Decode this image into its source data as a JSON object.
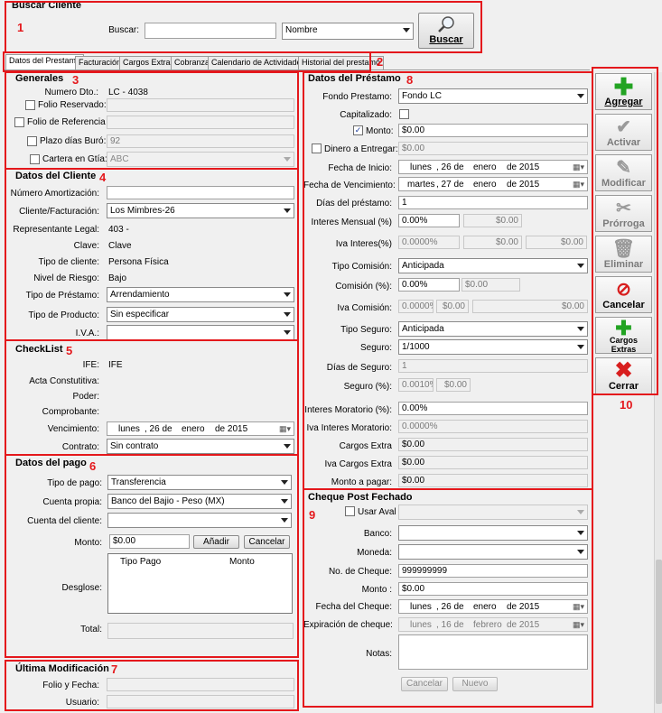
{
  "annotations": {
    "n1": "1",
    "n2": "2",
    "n3": "3",
    "n4": "4",
    "n5": "5",
    "n6": "6",
    "n7": "7",
    "n8": "8",
    "n9": "9",
    "n10": "10"
  },
  "search": {
    "title": "Buscar Cliente",
    "label": "Buscar:",
    "value": "",
    "field": "Nombre",
    "button": "Buscar"
  },
  "tabs": [
    "Datos del Prestamo",
    "Facturación",
    "Cargos Extras",
    "Cobranza",
    "Calendario de Actividades",
    "Historial del prestamo"
  ],
  "generales": {
    "title": "Generales",
    "numero_label": "Numero Dto.:",
    "numero_value": "LC - 4038",
    "folio_reservado": "Folio Reservado:",
    "folio_referencia": "Folio de Referencia",
    "plazo_buro": "Plazo días Buró:",
    "plazo_buro_value": "92",
    "cartera": "Cartera en Gtía:",
    "cartera_value": "ABC"
  },
  "cliente": {
    "title": "Datos del Cliente",
    "numero_amort": "Número Amortización:",
    "cliente_fact": "Cliente/Facturación:",
    "cliente_fact_value": "Los Mimbres-26",
    "rep_legal": "Representante Legal:",
    "rep_legal_value": "403 -",
    "clave": "Clave:",
    "clave_value": "Clave",
    "tipo_cliente": "Tipo de cliente:",
    "tipo_cliente_value": "Persona Física",
    "riesgo": "Nivel de Riesgo:",
    "riesgo_value": "Bajo",
    "tipo_prestamo": "Tipo de Préstamo:",
    "tipo_prestamo_value": "Arrendamiento",
    "tipo_producto": "Tipo de Producto:",
    "tipo_producto_value": "Sin especificar",
    "iva": "I.V.A.:",
    "iva_value": ""
  },
  "checklist": {
    "title": "CheckList",
    "ife": "IFE:",
    "ife_value": "IFE",
    "acta": "Acta Constutitiva:",
    "poder": "Poder:",
    "comprobante": "Comprobante:",
    "vencimiento": "Vencimiento:",
    "venc_day": "lunes",
    "venc_num": ", 26 de",
    "venc_month": "enero",
    "venc_year": "de 2015",
    "contrato": "Contrato:",
    "contrato_value": "Sin contrato"
  },
  "pago": {
    "title": "Datos del pago",
    "tipo": "Tipo de pago:",
    "tipo_value": "Transferencia",
    "cuenta_propia": "Cuenta propia:",
    "cuenta_propia_value": "Banco del Bajio - Peso (MX)",
    "cuenta_cliente": "Cuenta del cliente:",
    "monto": "Monto:",
    "monto_value": "$0.00",
    "anadir": "Añadir",
    "cancelar": "Cancelar",
    "desglose": "Desglose:",
    "col_tipo": "Tipo Pago",
    "col_monto": "Monto",
    "total": "Total:"
  },
  "ultima": {
    "title": "Última Modificación",
    "folio": "Folio y Fecha:",
    "usuario": "Usuario:"
  },
  "prestamo": {
    "title": "Datos del Préstamo",
    "fondo": "Fondo Prestamo:",
    "fondo_value": "Fondo LC",
    "capitalizado": "Capitalizado:",
    "monto": "Monto:",
    "monto_value": "$0.00",
    "dinero": "Dinero a Entregar:",
    "dinero_value": "$0.00",
    "fecha_inicio": "Fecha de Inicio:",
    "fi_day": "lunes",
    "fi_num": ", 26 de",
    "fi_month": "enero",
    "fi_year": "de 2015",
    "fecha_venc": "Fecha de Vencimiento:",
    "fv_day": "martes",
    "fv_num": ", 27 de",
    "fv_month": "enero",
    "fv_year": "de 2015",
    "dias": "Días del préstamo:",
    "dias_value": "1",
    "int_mensual": "Interes Mensual (%)",
    "int_mensual_value": "0.00%",
    "int_mensual_amt": "$0.00",
    "iva_int": "Iva Interes(%)",
    "iva_int_value": "0.0000%",
    "iva_int_a": "$0.00",
    "iva_int_b": "$0.00",
    "tipo_comision": "Tipo Comisión:",
    "tipo_comision_value": "Anticipada",
    "comision": "Comisión (%):",
    "comision_value": "0.00%",
    "comision_amt": "$0.00",
    "iva_comision": "Iva Comisión:",
    "iva_com_value": "0.0000%",
    "iva_com_a": "$0.00",
    "iva_com_b": "$0.00",
    "tipo_seguro": "Tipo Seguro:",
    "tipo_seguro_value": "Anticipada",
    "seguro": "Seguro:",
    "seguro_value": "1/1000",
    "dias_seguro": "Días de Seguro:",
    "dias_seguro_value": "1",
    "seguro_pct": "Seguro (%):",
    "seguro_pct_value": "0.0010%",
    "seguro_amt": "$0.00",
    "int_mora": "Interes Moratorio (%):",
    "int_mora_value": "0.00%",
    "iva_mora": "Iva Interes Moratorio:",
    "iva_mora_value": "0.0000%",
    "cargos": "Cargos Extra",
    "cargos_value": "$0.00",
    "iva_cargos": "Iva Cargos Extra",
    "iva_cargos_value": "$0.00",
    "monto_pagar": "Monto a pagar:",
    "monto_pagar_value": "$0.00"
  },
  "cheque": {
    "title": "Cheque Post Fechado",
    "usar_aval": "Usar Aval",
    "banco": "Banco:",
    "moneda": "Moneda:",
    "no_cheque": "No. de Cheque:",
    "no_cheque_value": "999999999",
    "monto": "Monto :",
    "monto_value": "$0.00",
    "fecha": "Fecha del Cheque:",
    "fc_day": "lunes",
    "fc_num": ", 26 de",
    "fc_month": "enero",
    "fc_year": "de 2015",
    "expiracion": "Expiración de cheque:",
    "ex_day": "lunes",
    "ex_num": ", 16 de",
    "ex_month": "febrero",
    "ex_year": "de 2015",
    "notas": "Notas:",
    "cancelar": "Cancelar",
    "nuevo": "Nuevo"
  },
  "actions": {
    "agregar": "Agregar",
    "activar": "Activar",
    "modificar": "Modificar",
    "prorroga": "Prórroga",
    "eliminar": "Eliminar",
    "cancelar": "Cancelar",
    "cargos_1": "Cargos",
    "cargos_2": "Extras",
    "cerrar": "Cerrar"
  },
  "colors": {
    "annotation_red": "#e4181c",
    "plus_green": "#22a322",
    "cancel_red": "#d81e1e"
  }
}
